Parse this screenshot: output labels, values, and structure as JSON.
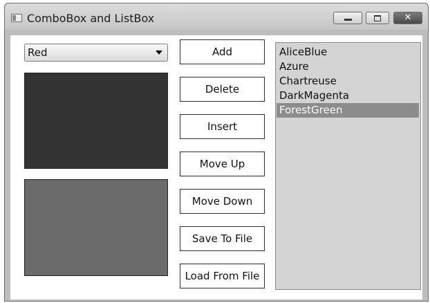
{
  "window": {
    "title": "ComboBox and ListBox",
    "minimize_glyph": "",
    "maximize_glyph": "",
    "close_glyph": "✕"
  },
  "combo": {
    "selected": "Red",
    "arrow_icon": "chevron-down-icon"
  },
  "swatches": [
    {
      "color": "#333333"
    },
    {
      "color": "#6b6b6b"
    }
  ],
  "buttons": [
    {
      "id": "add",
      "label": "Add"
    },
    {
      "id": "delete",
      "label": "Delete"
    },
    {
      "id": "insert",
      "label": "Insert"
    },
    {
      "id": "move-up",
      "label": "Move Up"
    },
    {
      "id": "move-down",
      "label": "Move Down"
    },
    {
      "id": "save-to-file",
      "label": "Save To File"
    },
    {
      "id": "load-from-file",
      "label": "Load From File"
    }
  ],
  "listbox": {
    "items": [
      "AliceBlue",
      "Azure",
      "Chartreuse",
      "DarkMagenta",
      "ForestGreen"
    ],
    "selected_index": 4
  },
  "colors": {
    "selection": "#8c8c8c",
    "listbox_bg": "#d4d4d4"
  }
}
